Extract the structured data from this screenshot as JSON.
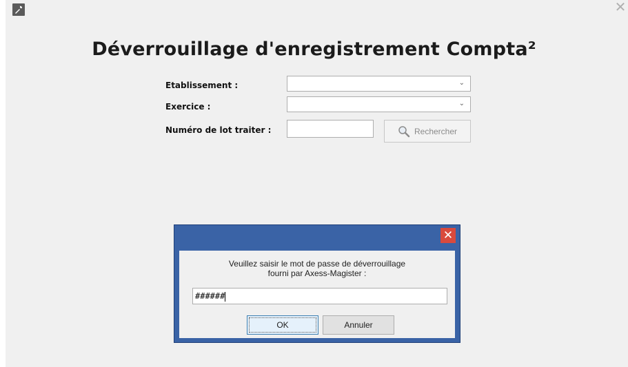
{
  "window": {
    "title": "Déverrouillage d'enregistrement Compta²",
    "close_glyph": "✕",
    "app_icon": "wrench-icon"
  },
  "form": {
    "etablissement_label": "Etablissement :",
    "etablissement_value": "",
    "exercice_label": "Exercice :",
    "exercice_value": "",
    "lot_label": "Numéro de lot traiter :",
    "lot_value": "",
    "search_button": "Rechercher",
    "search_icon": "magnifier-icon",
    "dropdown_glyph": "⌄"
  },
  "dialog": {
    "close_glyph": "✕",
    "message_line1": "Veuillez saisir le mot de passe de déverrouillage",
    "message_line2": "fourni par Axess-Magister :",
    "password_value": "######",
    "ok_label": "OK",
    "cancel_label": "Annuler"
  },
  "colors": {
    "dialog_frame": "#3a63a6",
    "dialog_close": "#d94a3d",
    "window_bg": "#f0f0f0"
  }
}
